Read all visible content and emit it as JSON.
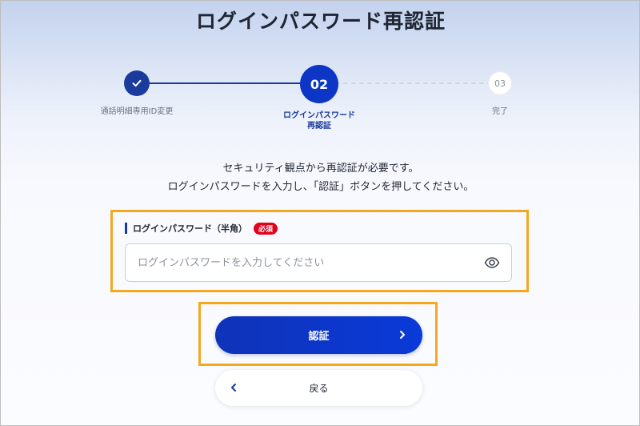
{
  "header": {
    "title": "ログインパスワード再認証"
  },
  "stepper": {
    "steps": [
      {
        "number": "",
        "label": "通話明細専用ID変更",
        "status": "completed"
      },
      {
        "number": "02",
        "label_line1": "ログインパスワード",
        "label_line2": "再認証",
        "status": "current"
      },
      {
        "number": "03",
        "label": "完了",
        "status": "upcoming"
      }
    ]
  },
  "instructions": {
    "line1": "セキュリティ観点から再認証が必要です。",
    "line2": "ログインパスワードを入力し、「認証」ボタンを押してください。"
  },
  "password_field": {
    "label": "ログインパスワード（半角）",
    "required_badge": "必須",
    "value": "",
    "placeholder": "ログインパスワードを入力してください",
    "toggle_icon": "eye-icon"
  },
  "buttons": {
    "authenticate_label": "認証",
    "back_label": "戻る"
  },
  "colors": {
    "primary": "#0d36c7",
    "completed": "#1a3a9c",
    "required": "#e2001a",
    "highlight": "#f4a820"
  }
}
